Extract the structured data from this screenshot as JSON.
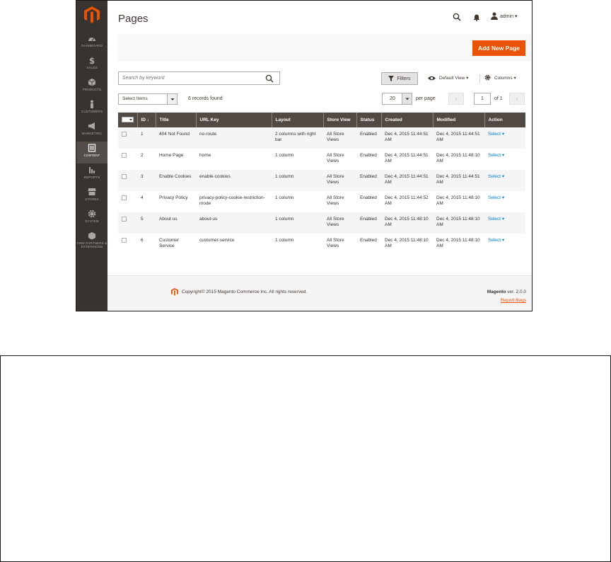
{
  "colors": {
    "sidebar": "#373330",
    "accent": "#eb5202",
    "grid_header": "#514943",
    "link": "#007bdb"
  },
  "sidebar": {
    "logo_icon": "magento-logo-icon",
    "items": [
      {
        "label": "DASHBOARD",
        "icon": "dashboard-icon"
      },
      {
        "label": "SALES",
        "icon": "dollar-icon"
      },
      {
        "label": "PRODUCTS",
        "icon": "cube-icon"
      },
      {
        "label": "CUSTOMERS",
        "icon": "person-icon"
      },
      {
        "label": "MARKETING",
        "icon": "megaphone-icon"
      },
      {
        "label": "CONTENT",
        "icon": "content-icon",
        "active": true
      },
      {
        "label": "REPORTS",
        "icon": "bar-chart-icon"
      },
      {
        "label": "STORES",
        "icon": "store-icon"
      },
      {
        "label": "SYSTEM",
        "icon": "gear-icon"
      },
      {
        "label": "FIND PARTNERS & EXTENSIONS",
        "icon": "partners-icon"
      }
    ]
  },
  "header": {
    "title": "Pages",
    "user": "admin ▾"
  },
  "toolbar": {
    "add_new_label": "Add New Page",
    "search_placeholder": "Search by keyword",
    "filters_label": "Filters",
    "default_view_label": "Default View ▾",
    "columns_label": "Columns ▾",
    "select_items_label": "Select Items",
    "records_found": "6 records found",
    "per_page_value": "20",
    "per_page_label": "per page",
    "prev_label": "‹",
    "current_page": "1",
    "of_label": "of 1",
    "next_label": "›"
  },
  "grid": {
    "columns": [
      "ID ↓",
      "Title",
      "URL Key",
      "Layout",
      "Store View",
      "Status",
      "Created",
      "Modified",
      "Action"
    ],
    "rows": [
      {
        "id": "1",
        "title": "404 Not Found",
        "url_key": "no-route",
        "layout": "2 columns with right bar",
        "store_view": "All Store Views",
        "status": "Enabled",
        "created": "Dec 4, 2015 11:44:51 AM",
        "modified": "Dec 4, 2015 11:44:51 AM",
        "action": "Select ▾"
      },
      {
        "id": "2",
        "title": "Home Page",
        "url_key": "home",
        "layout": "1 column",
        "store_view": "All Store Views",
        "status": "Enabled",
        "created": "Dec 4, 2015 11:44:51 AM",
        "modified": "Dec 4, 2015 11:48:10 AM",
        "action": "Select ▾"
      },
      {
        "id": "3",
        "title": "Enable Cookies",
        "url_key": "enable-cookies",
        "layout": "1 column",
        "store_view": "All Store Views",
        "status": "Enabled",
        "created": "Dec 4, 2015 11:44:51 AM",
        "modified": "Dec 4, 2015 11:44:51 AM",
        "action": "Select ▾"
      },
      {
        "id": "4",
        "title": "Privacy Policy",
        "url_key": "privacy-policy-cookie-restriction-mode",
        "layout": "1 column",
        "store_view": "All Store Views",
        "status": "Enabled",
        "created": "Dec 4, 2015 11:44:52 AM",
        "modified": "Dec 4, 2015 11:48:10 AM",
        "action": "Select ▾"
      },
      {
        "id": "5",
        "title": "About us",
        "url_key": "about-us",
        "layout": "1 column",
        "store_view": "All Store Views",
        "status": "Enabled",
        "created": "Dec 4, 2015 11:48:10 AM",
        "modified": "Dec 4, 2015 11:48:10 AM",
        "action": "Select ▾"
      },
      {
        "id": "6",
        "title": "Customer Service",
        "url_key": "customer-service",
        "layout": "1 column",
        "store_view": "All Store Views",
        "status": "Enabled",
        "created": "Dec 4, 2015 11:48:10 AM",
        "modified": "Dec 4, 2015 11:48:10 AM",
        "action": "Select ▾"
      }
    ]
  },
  "footer": {
    "copyright": "Copyright© 2015 Magento Commerce Inc. All rights reserved.",
    "brand": "Magento",
    "version": " ver. 2.0.0",
    "report_bugs": "Report Bugs"
  }
}
